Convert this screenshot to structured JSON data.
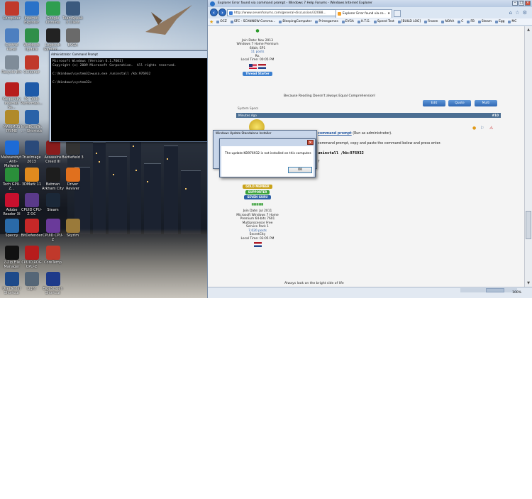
{
  "desktop": {
    "icons": [
      {
        "label": "Computer",
        "icon": "computer-icon",
        "color": "#c0392b"
      },
      {
        "label": "Internet Explorer",
        "icon": "ie-icon",
        "color": "#2a72c8"
      },
      {
        "label": "Google Chrome",
        "icon": "chrome-icon",
        "color": "#2e9e4f"
      },
      {
        "label": "TeamSpeak 3 Client",
        "icon": "teamspeak-icon",
        "color": "#3b5a7e"
      },
      {
        "label": "Control Panel",
        "icon": "control-panel-icon",
        "color": "#4d7fc0"
      },
      {
        "label": "Windows Update",
        "icon": "windows-update-icon",
        "color": "#2f8f4a"
      },
      {
        "label": "Logitech Gaming ...",
        "icon": "logitech-icon",
        "color": "#222222"
      },
      {
        "label": "EVGA",
        "icon": "evga-icon",
        "color": "#6a6a6a"
      },
      {
        "label": "Recycle Bin",
        "icon": "recycle-bin-icon",
        "color": "#7f8c99"
      },
      {
        "label": "CCleaner",
        "icon": "ccleaner-icon",
        "color": "#c0392b"
      },
      {
        "label": "Kaspersky Internet Se...",
        "icon": "kaspersky-icon",
        "color": "#b71c1c"
      },
      {
        "label": "PC Tools Performan...",
        "icon": "pc-tools-icon",
        "color": "#1e5aa8"
      },
      {
        "label": "MAXIMUS PRIME",
        "icon": "maximus-icon",
        "color": "#b08a2a"
      },
      {
        "label": "IntelBurnTe... - Shortcut",
        "icon": "intelburntest-icon",
        "color": "#2a62a8"
      },
      {
        "label": "Malwarebyt... Anti-Malware",
        "icon": "malwarebytes-icon",
        "color": "#1e6bd6"
      },
      {
        "label": "TrueImage 2013",
        "icon": "trueimage-icon",
        "color": "#2a4a7a"
      },
      {
        "label": "Assassins Creed III",
        "icon": "assassins-creed-icon",
        "color": "#8a1c1c"
      },
      {
        "label": "Battlefield 3",
        "icon": "battlefield-icon",
        "color": "#333333"
      },
      {
        "label": "Tech GPU-Z...",
        "icon": "gpu-z-icon",
        "color": "#2a8f3a"
      },
      {
        "label": "3DMark 11",
        "icon": "3dmark-icon",
        "color": "#e08a1e"
      },
      {
        "label": "Batman Arkham City",
        "icon": "batman-icon",
        "color": "#1d1d1d"
      },
      {
        "label": "Driver Reviver",
        "icon": "driver-reviver-icon",
        "color": "#e0701e"
      },
      {
        "label": "Adobe Reader XI",
        "icon": "adobe-reader-icon",
        "color": "#c8102e"
      },
      {
        "label": "CPUID CPU-Z OC",
        "icon": "cpu-z-icon",
        "color": "#5a3a8a"
      },
      {
        "label": "Steam",
        "icon": "steam-icon",
        "color": "#1b2838"
      },
      {
        "label": "Speccy",
        "icon": "speccy-icon",
        "color": "#2a6aa8"
      },
      {
        "label": "BitDefender",
        "icon": "bitdefender-icon",
        "color": "#c62828"
      },
      {
        "label": "CPUID CPU-Z",
        "icon": "cpuid-cpu-z-icon",
        "color": "#6a3a9a"
      },
      {
        "label": "Skyrim",
        "icon": "skyrim-icon",
        "color": "#9a7a3a"
      },
      {
        "label": "7-Zip File Manager",
        "icon": "7zip-icon",
        "color": "#111111"
      },
      {
        "label": "CPUID ROG CPU-Z",
        "icon": "rog-cpu-z-icon",
        "color": "#b71c1c"
      },
      {
        "label": "CoreTemp",
        "icon": "coretemp-icon",
        "color": "#c0392b"
      },
      {
        "label": "UserTester Shortcut",
        "icon": "usertester-icon",
        "color": "#1e4a8a"
      },
      {
        "label": "Light",
        "icon": "light-icon",
        "color": "#556677"
      },
      {
        "label": "BlueScreen Shortcut",
        "icon": "bluescreen-icon",
        "color": "#1e3a8a"
      }
    ]
  },
  "cmd": {
    "title": "Administrator: Command Prompt",
    "lines": [
      "Microsoft Windows [Version 6.1.7601]",
      "Copyright (c) 2009 Microsoft Corporation.  All rights reserved.",
      "",
      "C:\\Windows\\system32>wusa.exe /uninstall /kb:976932",
      "",
      "C:\\Windows\\system32>"
    ]
  },
  "ie": {
    "title": "Explorer Error found via command prompt - Windows 7 Help Forums - Windows Internet Explorer",
    "address": "http://www.sevenforums.com/general-discussion/32088...",
    "tab_title": "Explorer Error found via co...",
    "favorites": [
      "OCZ",
      "SFC - SCANNOW Comma...",
      "BleepingComputer",
      "Primegames",
      "EVGA",
      "H.T.G.",
      "Speed Test",
      "[BUILD LOG]",
      "Frozen",
      "NOAA",
      "C",
      "FB",
      "Steam",
      "Egg",
      "MC"
    ],
    "zoom": "100%",
    "post1": {
      "join_date": "Join Date: Nov 2013",
      "system": "Windows 7 Home Premium 64bit, SP1",
      "posts": "11 posts",
      "location": "Ro.",
      "local_time": "Local Time: 00:05 PM",
      "starter": "Thread Starter",
      "signature": "Because Reading Doesn't always Equal Comprehension!",
      "buttons": [
        "Edit",
        "Quote",
        "Multi"
      ],
      "sys_spec": "System Specs"
    },
    "post2": {
      "header_time": "Minutes Ago",
      "post_no": "#10",
      "link_text": "command prompt",
      "after_link": "(Run as administrator).",
      "line2": "command prompt, copy and paste the command below and press enter.",
      "command": "uninstall /kb:976932",
      "qmark": "?",
      "badges": [
        "GOLD MEMBER",
        "SUPPORTER",
        "SEVEN GURU"
      ],
      "join_date": "Join Date: Jul 2011",
      "system": "Microsoft Windows 7 Home Premium 64-bits 7601 Multiprocessor Free Service Pack 1",
      "posts": "7,020 posts",
      "location": "SecretCity",
      "local_time": "Local Time: 03:05 PM",
      "signature": "Always look on the bright side of life"
    }
  },
  "wu_back": {
    "title": "Windows Update Standalone Installer"
  },
  "wu_dialog": {
    "title": "Windows Update Standalone Installer",
    "message": "The update KB976932 is not installed on this computer.",
    "ok": "OK"
  }
}
